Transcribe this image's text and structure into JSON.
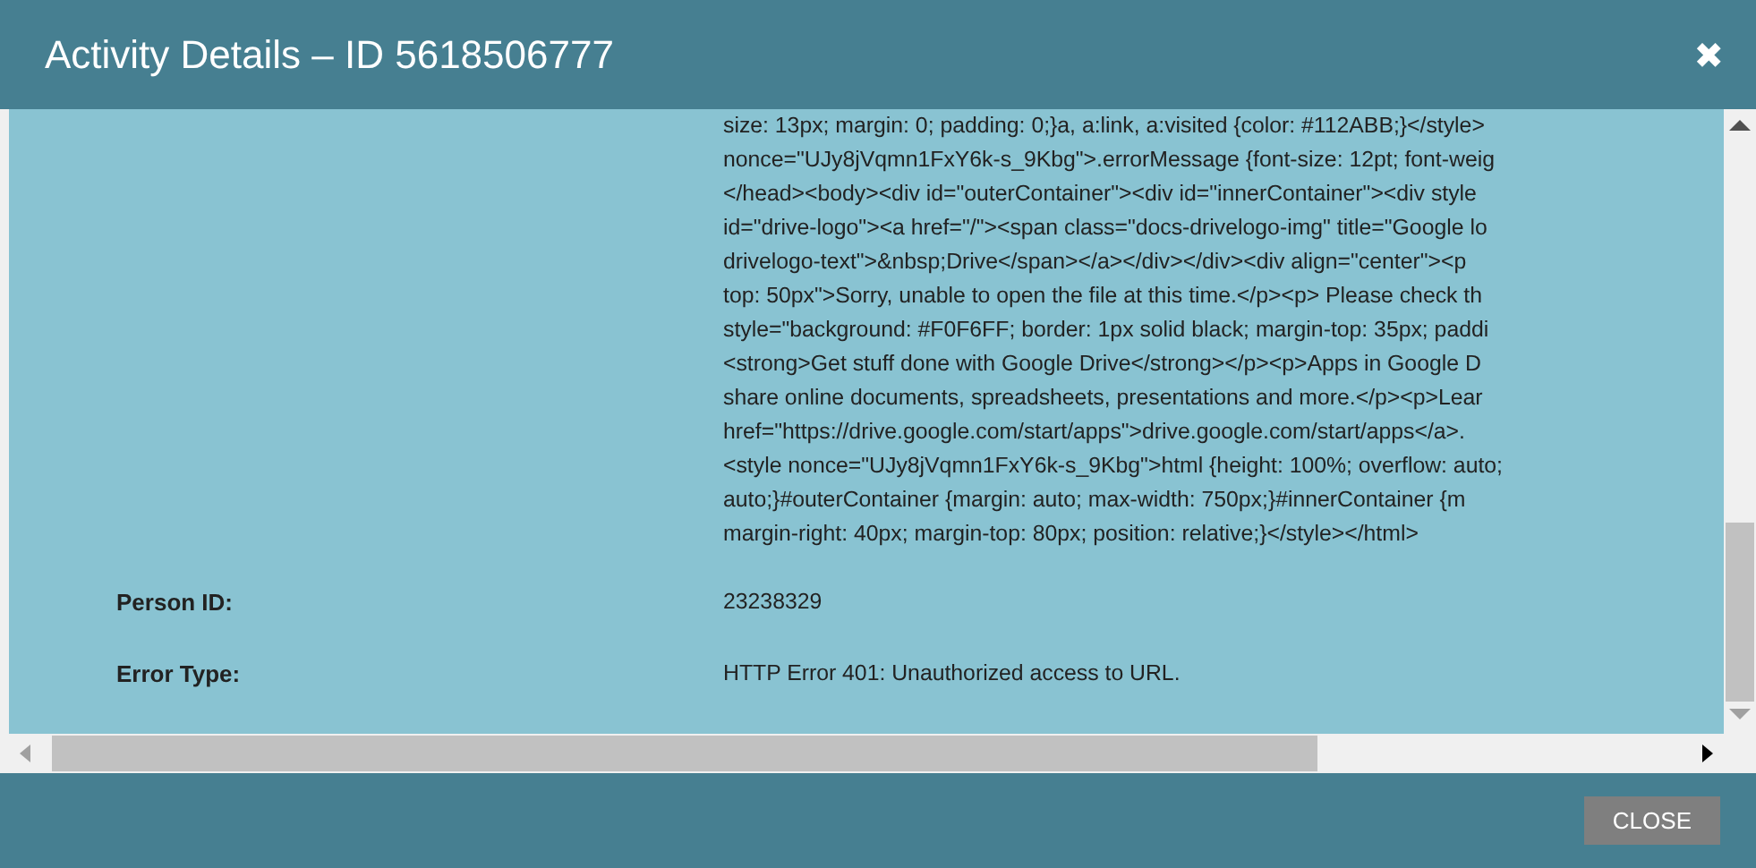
{
  "dialog": {
    "title": "Activity Details – ID 5618506777",
    "close_icon": "✖"
  },
  "details": [
    {
      "value_lines": [
        "size: 13px; margin: 0; padding: 0;}a, a:link, a:visited {color: #112ABB;}</style>",
        "nonce=\"UJy8jVqmn1FxY6k-s_9Kbg\">.errorMessage {font-size: 12pt; font-weig",
        "</head><body><div id=\"outerContainer\"><div id=\"innerContainer\"><div style",
        "id=\"drive-logo\"><a href=\"/\"><span class=\"docs-drivelogo-img\" title=\"Google lo",
        "drivelogo-text\">&nbsp;Drive</span></a></div></div><div align=\"center\"><p",
        "top: 50px\">Sorry, unable to open the file at this time.</p><p> Please check th",
        "style=\"background: #F0F6FF; border: 1px solid black; margin-top: 35px; paddi",
        "<strong>Get stuff done with Google Drive</strong></p><p>Apps in Google D",
        "share online documents, spreadsheets, presentations and more.</p><p>Lear",
        "href=\"https://drive.google.com/start/apps\">drive.google.com/start/apps</a>.",
        "<style nonce=\"UJy8jVqmn1FxY6k-s_9Kbg\">html {height: 100%; overflow: auto;",
        "auto;}#outerContainer {margin: auto; max-width: 750px;}#innerContainer {m",
        "margin-right: 40px; margin-top: 80px; position: relative;}</style></html>"
      ]
    },
    {
      "label": "Person ID:",
      "value_lines": [
        "23238329"
      ]
    },
    {
      "label": "Error Type:",
      "value_lines": [
        "HTTP Error 401: Unauthorized access to URL."
      ]
    }
  ],
  "buttons": [
    {
      "label": "CLOSE"
    }
  ]
}
